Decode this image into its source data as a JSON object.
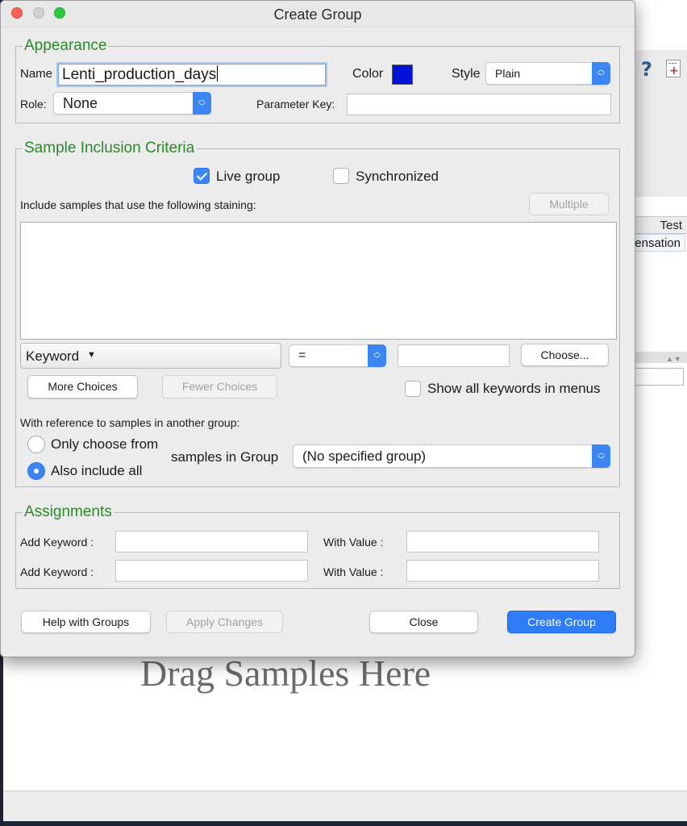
{
  "background": {
    "table_header": "Test",
    "row_text": "ensation",
    "drag_text": "Drag Samples Here"
  },
  "dialog": {
    "title": "Create Group",
    "appearance": {
      "legend": "Appearance",
      "name_label": "Name",
      "name_value": "Lenti_production_days",
      "color_label": "Color",
      "color_value": "#0011d8",
      "style_label": "Style",
      "style_value": "Plain",
      "role_label": "Role:",
      "role_value": "None",
      "parameter_key_label": "Parameter Key:",
      "parameter_key_value": ""
    },
    "criteria": {
      "legend": "Sample Inclusion Criteria",
      "live_group_label": "Live group",
      "live_group_checked": true,
      "synchronized_label": "Synchronized",
      "synchronized_checked": false,
      "include_label": "Include samples that use the following staining:",
      "multiple_button": "Multiple",
      "keyword_combo": "Keyword",
      "operator_value": "=",
      "value_field": "",
      "choose_button": "Choose...",
      "more_choices_button": "More Choices",
      "fewer_choices_button": "Fewer Choices",
      "show_all_label": "Show all keywords in menus",
      "show_all_checked": false,
      "reference_label": "With reference to samples in another group:",
      "only_choose_label": "Only choose from",
      "also_include_label": "Also include all",
      "selected_option": "Also include all",
      "samples_in_group_label": "samples in Group",
      "group_value": "(No specified group)"
    },
    "assignments": {
      "legend": "Assignments",
      "rows": [
        {
          "keyword_label": "Add Keyword :",
          "keyword_value": "",
          "value_label": "With Value :",
          "value_value": ""
        },
        {
          "keyword_label": "Add Keyword :",
          "keyword_value": "",
          "value_label": "With Value :",
          "value_value": ""
        }
      ]
    },
    "buttons": {
      "help": "Help with Groups",
      "apply": "Apply Changes",
      "close": "Close",
      "create": "Create Group"
    }
  }
}
